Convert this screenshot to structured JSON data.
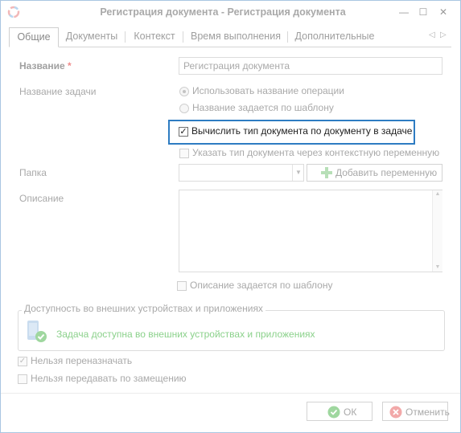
{
  "window": {
    "title": "Регистрация документа - Регистрация документа",
    "minimize_glyph": "—",
    "maximize_glyph": "☐",
    "close_glyph": "✕"
  },
  "tabs": {
    "items": [
      {
        "label": "Общие"
      },
      {
        "label": "Документы"
      },
      {
        "label": "Контекст"
      },
      {
        "label": "Время выполнения"
      },
      {
        "label": "Дополнительные"
      }
    ],
    "active_index": 0,
    "prev_glyph": "◁",
    "next_glyph": "▷"
  },
  "form": {
    "name_label": "Название",
    "required_mark": "*",
    "name_value": "Регистрация документа",
    "task_name_label": "Название задачи",
    "radio_use_operation": "Использовать название операции",
    "radio_by_template": "Название задается по шаблону",
    "calc_doc_type": "Вычислить тип документа по документу в задаче",
    "calc_doc_type_checked": true,
    "context_doc_type": "Указать тип документа через контекстную переменную",
    "folder_label": "Папка",
    "folder_value": "",
    "add_variable_button": "Добавить переменную",
    "description_label": "Описание",
    "description_value": "",
    "description_by_template": "Описание задается по шаблону"
  },
  "availability": {
    "group_title": "Доступность во внешних устройствах и приложениях",
    "status_text": "Задача доступна во внешних устройствах и приложениях",
    "status_color": "#8bd18b"
  },
  "options": {
    "no_reassign": "Нельзя переназначать",
    "no_reassign_checked": true,
    "no_substitute": "Нельзя передавать по замещению",
    "no_substitute_checked": false
  },
  "footer": {
    "ok_label": "ОК",
    "cancel_label": "Отменить"
  },
  "colors": {
    "highlight_border": "#2e7cc2",
    "ok_icon": "#9fd79f",
    "cancel_icon": "#f2a9a9"
  }
}
